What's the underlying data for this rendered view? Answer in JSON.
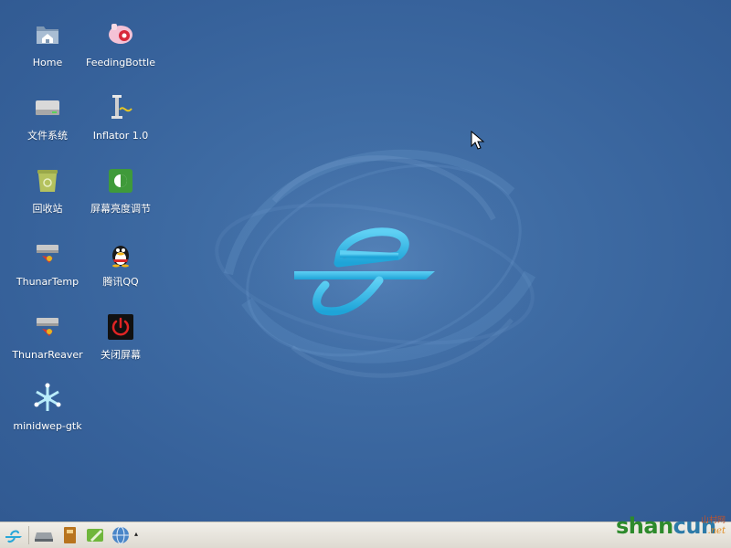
{
  "desktop": {
    "icons": [
      {
        "label": "Home",
        "icon": "home-folder-icon"
      },
      {
        "label": "FeedingBottle",
        "icon": "feeding-bottle-icon"
      },
      {
        "label": "文件系统",
        "icon": "filesystem-drive-icon"
      },
      {
        "label": "Inflator 1.0",
        "icon": "inflator-pump-icon"
      },
      {
        "label": "回收站",
        "icon": "trash-icon"
      },
      {
        "label": "屏幕亮度调节",
        "icon": "brightness-icon"
      },
      {
        "label": "ThunarTemp",
        "icon": "thunar-temp-icon"
      },
      {
        "label": "腾讯QQ",
        "icon": "qq-penguin-icon"
      },
      {
        "label": "ThunarReaver",
        "icon": "thunar-reaver-icon"
      },
      {
        "label": "关闭屏幕",
        "icon": "power-icon"
      },
      {
        "label": "minidwep-gtk",
        "icon": "minidwep-icon"
      }
    ]
  },
  "taskbar": {
    "items": [
      "menu-logo-icon",
      "drive-icon",
      "book-icon",
      "pen-editor-icon",
      "globe-browser-icon"
    ],
    "arrow": "▴"
  },
  "watermark": {
    "brand_a": "shan",
    "brand_b": "cun",
    "sub": "山村网",
    "net": ".net"
  },
  "colors": {
    "desktop_bg": "#3e6ba3",
    "logo": "#29b8e8",
    "taskbar": "#e8e6df"
  }
}
